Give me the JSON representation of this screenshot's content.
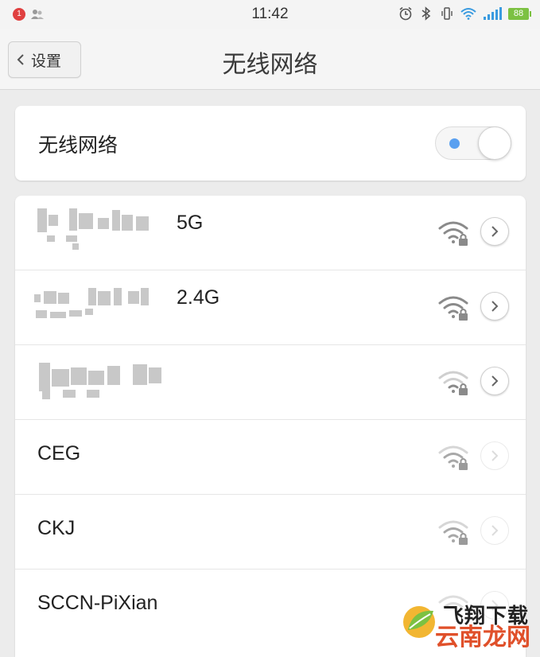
{
  "status_bar": {
    "notification_count": "1",
    "time": "11:42",
    "battery_level": "88",
    "battery_color": "#7cc142"
  },
  "header": {
    "back_label": "设置",
    "title": "无线网络"
  },
  "wifi_toggle": {
    "label": "无线网络",
    "enabled": true,
    "accent": "#5aa0f0"
  },
  "networks": [
    {
      "name": "5G",
      "name_obscured": true,
      "secured": true,
      "signal": 4,
      "in_range": true
    },
    {
      "name": "2.4G",
      "name_obscured": true,
      "secured": true,
      "signal": 4,
      "in_range": true
    },
    {
      "name": "",
      "name_obscured": true,
      "secured": true,
      "signal": 2,
      "in_range": true
    },
    {
      "name": "CEG",
      "name_obscured": false,
      "secured": true,
      "signal": 2,
      "in_range": false
    },
    {
      "name": "CKJ",
      "name_obscured": false,
      "secured": true,
      "signal": 2,
      "in_range": false
    },
    {
      "name": "SCCN-PiXian",
      "name_obscured": false,
      "secured": true,
      "signal": 1,
      "in_range": false
    }
  ],
  "watermark": {
    "line1": "飞翔下载",
    "line2": "云南龙网",
    "accent": "#e0502a"
  }
}
